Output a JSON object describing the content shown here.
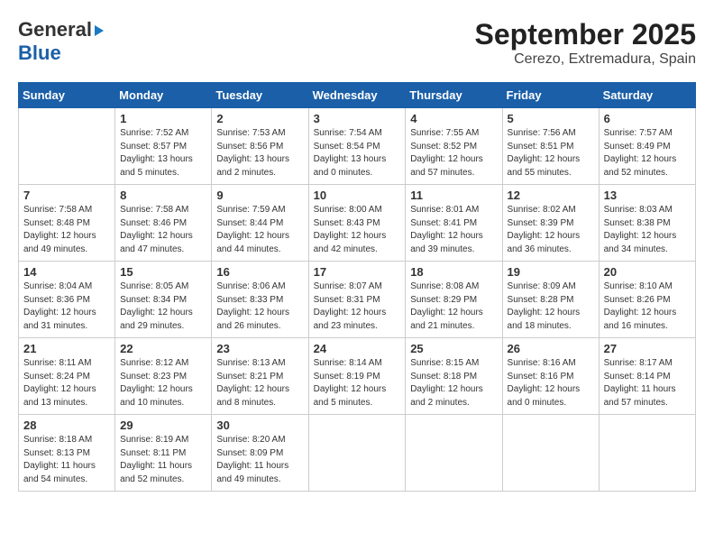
{
  "header": {
    "logo_line1": "General",
    "logo_line2": "Blue",
    "title": "September 2025",
    "subtitle": "Cerezo, Extremadura, Spain"
  },
  "days_of_week": [
    "Sunday",
    "Monday",
    "Tuesday",
    "Wednesday",
    "Thursday",
    "Friday",
    "Saturday"
  ],
  "weeks": [
    [
      {
        "day": "",
        "info": ""
      },
      {
        "day": "1",
        "info": "Sunrise: 7:52 AM\nSunset: 8:57 PM\nDaylight: 13 hours\nand 5 minutes."
      },
      {
        "day": "2",
        "info": "Sunrise: 7:53 AM\nSunset: 8:56 PM\nDaylight: 13 hours\nand 2 minutes."
      },
      {
        "day": "3",
        "info": "Sunrise: 7:54 AM\nSunset: 8:54 PM\nDaylight: 13 hours\nand 0 minutes."
      },
      {
        "day": "4",
        "info": "Sunrise: 7:55 AM\nSunset: 8:52 PM\nDaylight: 12 hours\nand 57 minutes."
      },
      {
        "day": "5",
        "info": "Sunrise: 7:56 AM\nSunset: 8:51 PM\nDaylight: 12 hours\nand 55 minutes."
      },
      {
        "day": "6",
        "info": "Sunrise: 7:57 AM\nSunset: 8:49 PM\nDaylight: 12 hours\nand 52 minutes."
      }
    ],
    [
      {
        "day": "7",
        "info": "Sunrise: 7:58 AM\nSunset: 8:48 PM\nDaylight: 12 hours\nand 49 minutes."
      },
      {
        "day": "8",
        "info": "Sunrise: 7:58 AM\nSunset: 8:46 PM\nDaylight: 12 hours\nand 47 minutes."
      },
      {
        "day": "9",
        "info": "Sunrise: 7:59 AM\nSunset: 8:44 PM\nDaylight: 12 hours\nand 44 minutes."
      },
      {
        "day": "10",
        "info": "Sunrise: 8:00 AM\nSunset: 8:43 PM\nDaylight: 12 hours\nand 42 minutes."
      },
      {
        "day": "11",
        "info": "Sunrise: 8:01 AM\nSunset: 8:41 PM\nDaylight: 12 hours\nand 39 minutes."
      },
      {
        "day": "12",
        "info": "Sunrise: 8:02 AM\nSunset: 8:39 PM\nDaylight: 12 hours\nand 36 minutes."
      },
      {
        "day": "13",
        "info": "Sunrise: 8:03 AM\nSunset: 8:38 PM\nDaylight: 12 hours\nand 34 minutes."
      }
    ],
    [
      {
        "day": "14",
        "info": "Sunrise: 8:04 AM\nSunset: 8:36 PM\nDaylight: 12 hours\nand 31 minutes."
      },
      {
        "day": "15",
        "info": "Sunrise: 8:05 AM\nSunset: 8:34 PM\nDaylight: 12 hours\nand 29 minutes."
      },
      {
        "day": "16",
        "info": "Sunrise: 8:06 AM\nSunset: 8:33 PM\nDaylight: 12 hours\nand 26 minutes."
      },
      {
        "day": "17",
        "info": "Sunrise: 8:07 AM\nSunset: 8:31 PM\nDaylight: 12 hours\nand 23 minutes."
      },
      {
        "day": "18",
        "info": "Sunrise: 8:08 AM\nSunset: 8:29 PM\nDaylight: 12 hours\nand 21 minutes."
      },
      {
        "day": "19",
        "info": "Sunrise: 8:09 AM\nSunset: 8:28 PM\nDaylight: 12 hours\nand 18 minutes."
      },
      {
        "day": "20",
        "info": "Sunrise: 8:10 AM\nSunset: 8:26 PM\nDaylight: 12 hours\nand 16 minutes."
      }
    ],
    [
      {
        "day": "21",
        "info": "Sunrise: 8:11 AM\nSunset: 8:24 PM\nDaylight: 12 hours\nand 13 minutes."
      },
      {
        "day": "22",
        "info": "Sunrise: 8:12 AM\nSunset: 8:23 PM\nDaylight: 12 hours\nand 10 minutes."
      },
      {
        "day": "23",
        "info": "Sunrise: 8:13 AM\nSunset: 8:21 PM\nDaylight: 12 hours\nand 8 minutes."
      },
      {
        "day": "24",
        "info": "Sunrise: 8:14 AM\nSunset: 8:19 PM\nDaylight: 12 hours\nand 5 minutes."
      },
      {
        "day": "25",
        "info": "Sunrise: 8:15 AM\nSunset: 8:18 PM\nDaylight: 12 hours\nand 2 minutes."
      },
      {
        "day": "26",
        "info": "Sunrise: 8:16 AM\nSunset: 8:16 PM\nDaylight: 12 hours\nand 0 minutes."
      },
      {
        "day": "27",
        "info": "Sunrise: 8:17 AM\nSunset: 8:14 PM\nDaylight: 11 hours\nand 57 minutes."
      }
    ],
    [
      {
        "day": "28",
        "info": "Sunrise: 8:18 AM\nSunset: 8:13 PM\nDaylight: 11 hours\nand 54 minutes."
      },
      {
        "day": "29",
        "info": "Sunrise: 8:19 AM\nSunset: 8:11 PM\nDaylight: 11 hours\nand 52 minutes."
      },
      {
        "day": "30",
        "info": "Sunrise: 8:20 AM\nSunset: 8:09 PM\nDaylight: 11 hours\nand 49 minutes."
      },
      {
        "day": "",
        "info": ""
      },
      {
        "day": "",
        "info": ""
      },
      {
        "day": "",
        "info": ""
      },
      {
        "day": "",
        "info": ""
      }
    ]
  ]
}
